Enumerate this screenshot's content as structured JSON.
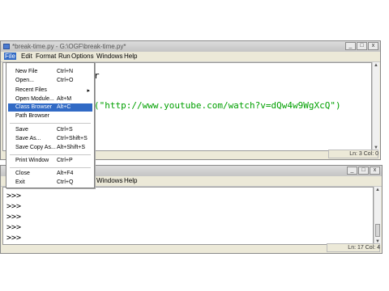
{
  "editor_window": {
    "title": "*break-time.py - G:\\OGF\\break-time.py*",
    "menus": [
      "File",
      "Edit",
      "Format",
      "Run",
      "Options",
      "Windows",
      "Help"
    ],
    "code_fragment_top": "r",
    "code_line_url": "(\"http://www.youtube.com/watch?v=dQw4w9WgXcQ\")",
    "status": "Ln: 3 Col: 0"
  },
  "file_menu": {
    "items": [
      {
        "label": "New File",
        "shortcut": "Ctrl+N"
      },
      {
        "label": "Open...",
        "shortcut": "Ctrl+O"
      },
      {
        "label": "Recent Files",
        "shortcut": ""
      },
      {
        "label": "Open Module...",
        "shortcut": "Alt+M"
      },
      {
        "label": "Class Browser",
        "shortcut": "Alt+C"
      },
      {
        "label": "Path Browser",
        "shortcut": ""
      },
      {
        "label": "Save",
        "shortcut": "Ctrl+S"
      },
      {
        "label": "Save As...",
        "shortcut": "Ctrl+Shift+S"
      },
      {
        "label": "Save Copy As...",
        "shortcut": "Alt+Shift+S"
      },
      {
        "label": "Print Window",
        "shortcut": "Ctrl+P"
      },
      {
        "label": "Close",
        "shortcut": "Alt+F4"
      },
      {
        "label": "Exit",
        "shortcut": "Ctrl+Q"
      }
    ],
    "submenu_arrow": "▸"
  },
  "shell_window": {
    "menus_visible": [
      "Windows",
      "Help"
    ],
    "prompts": [
      ">>>",
      ">>>",
      ">>>",
      ">>>",
      ">>>"
    ],
    "status": "Ln: 17 Col: 4"
  },
  "window_controls": {
    "minimize": "_",
    "maximize": "□",
    "close": "x"
  }
}
